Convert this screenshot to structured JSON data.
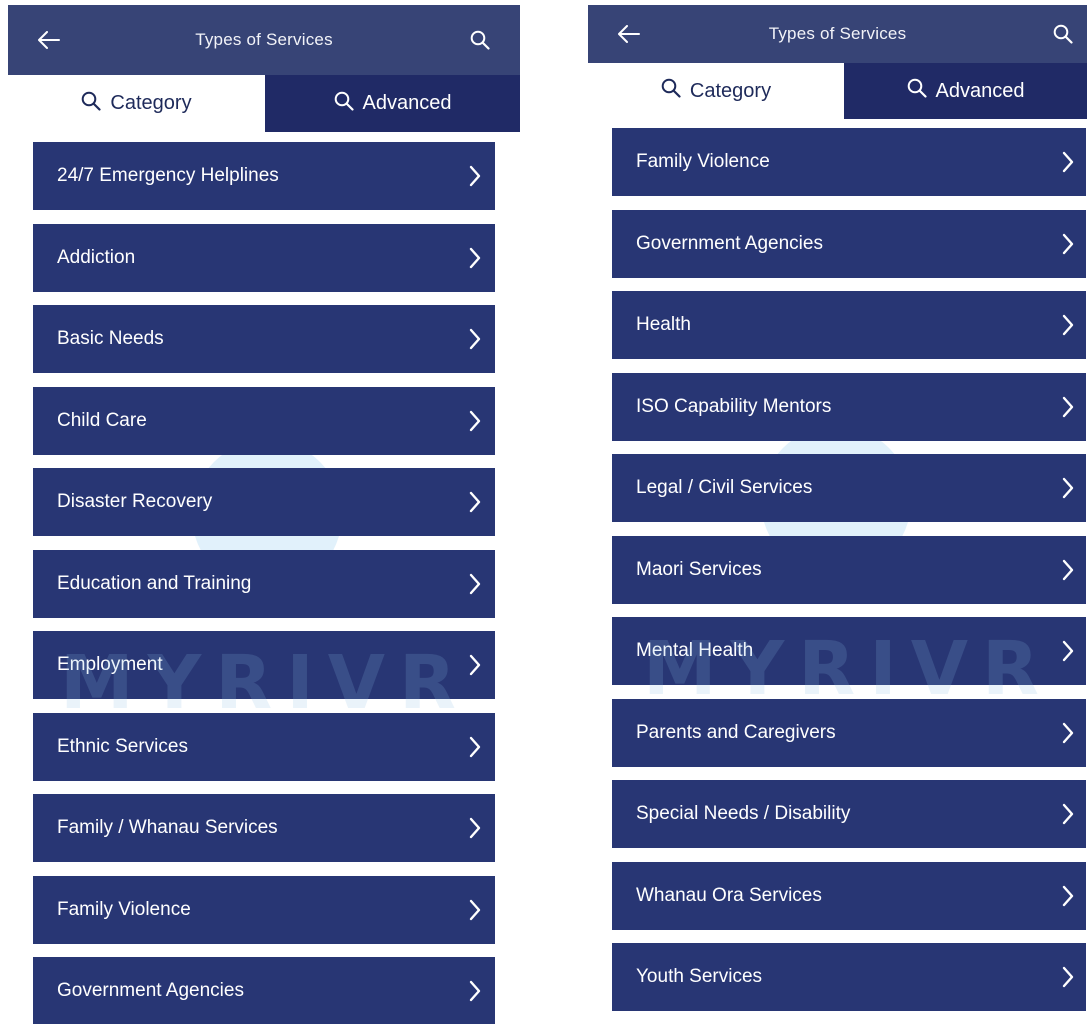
{
  "screens": [
    {
      "header": {
        "title": "Types of Services"
      },
      "tabs": [
        {
          "label": "Category",
          "active": true
        },
        {
          "label": "Advanced",
          "active": false
        }
      ],
      "items": [
        {
          "label": "24/7 Emergency Helplines"
        },
        {
          "label": "Addiction"
        },
        {
          "label": "Basic Needs"
        },
        {
          "label": "Child Care"
        },
        {
          "label": "Disaster Recovery"
        },
        {
          "label": "Education and Training"
        },
        {
          "label": "Employment"
        },
        {
          "label": "Ethnic Services"
        },
        {
          "label": "Family / Whanau Services"
        },
        {
          "label": "Family Violence"
        },
        {
          "label": "Government Agencies"
        }
      ]
    },
    {
      "header": {
        "title": "Types of Services"
      },
      "tabs": [
        {
          "label": "Category",
          "active": true
        },
        {
          "label": "Advanced",
          "active": false
        }
      ],
      "items": [
        {
          "label": "Family Violence"
        },
        {
          "label": "Government Agencies"
        },
        {
          "label": "Health"
        },
        {
          "label": "ISO Capability Mentors"
        },
        {
          "label": "Legal / Civil Services"
        },
        {
          "label": "Maori Services"
        },
        {
          "label": "Mental Health"
        },
        {
          "label": "Parents and Caregivers"
        },
        {
          "label": "Special Needs / Disability"
        },
        {
          "label": "Whanau Ora Services"
        },
        {
          "label": "Youth Services"
        }
      ]
    }
  ],
  "watermark": {
    "text": "MYRIVR"
  },
  "icons": {
    "back": "arrow-left-icon",
    "search": "search-icon",
    "chevron": "chevron-right-icon"
  },
  "colors": {
    "header_bg": "#374476",
    "tab_inactive_bg": "#202a66",
    "tab_active_text": "#1e2a5a",
    "item_bg": "#283674",
    "text_light": "#ffffff"
  }
}
